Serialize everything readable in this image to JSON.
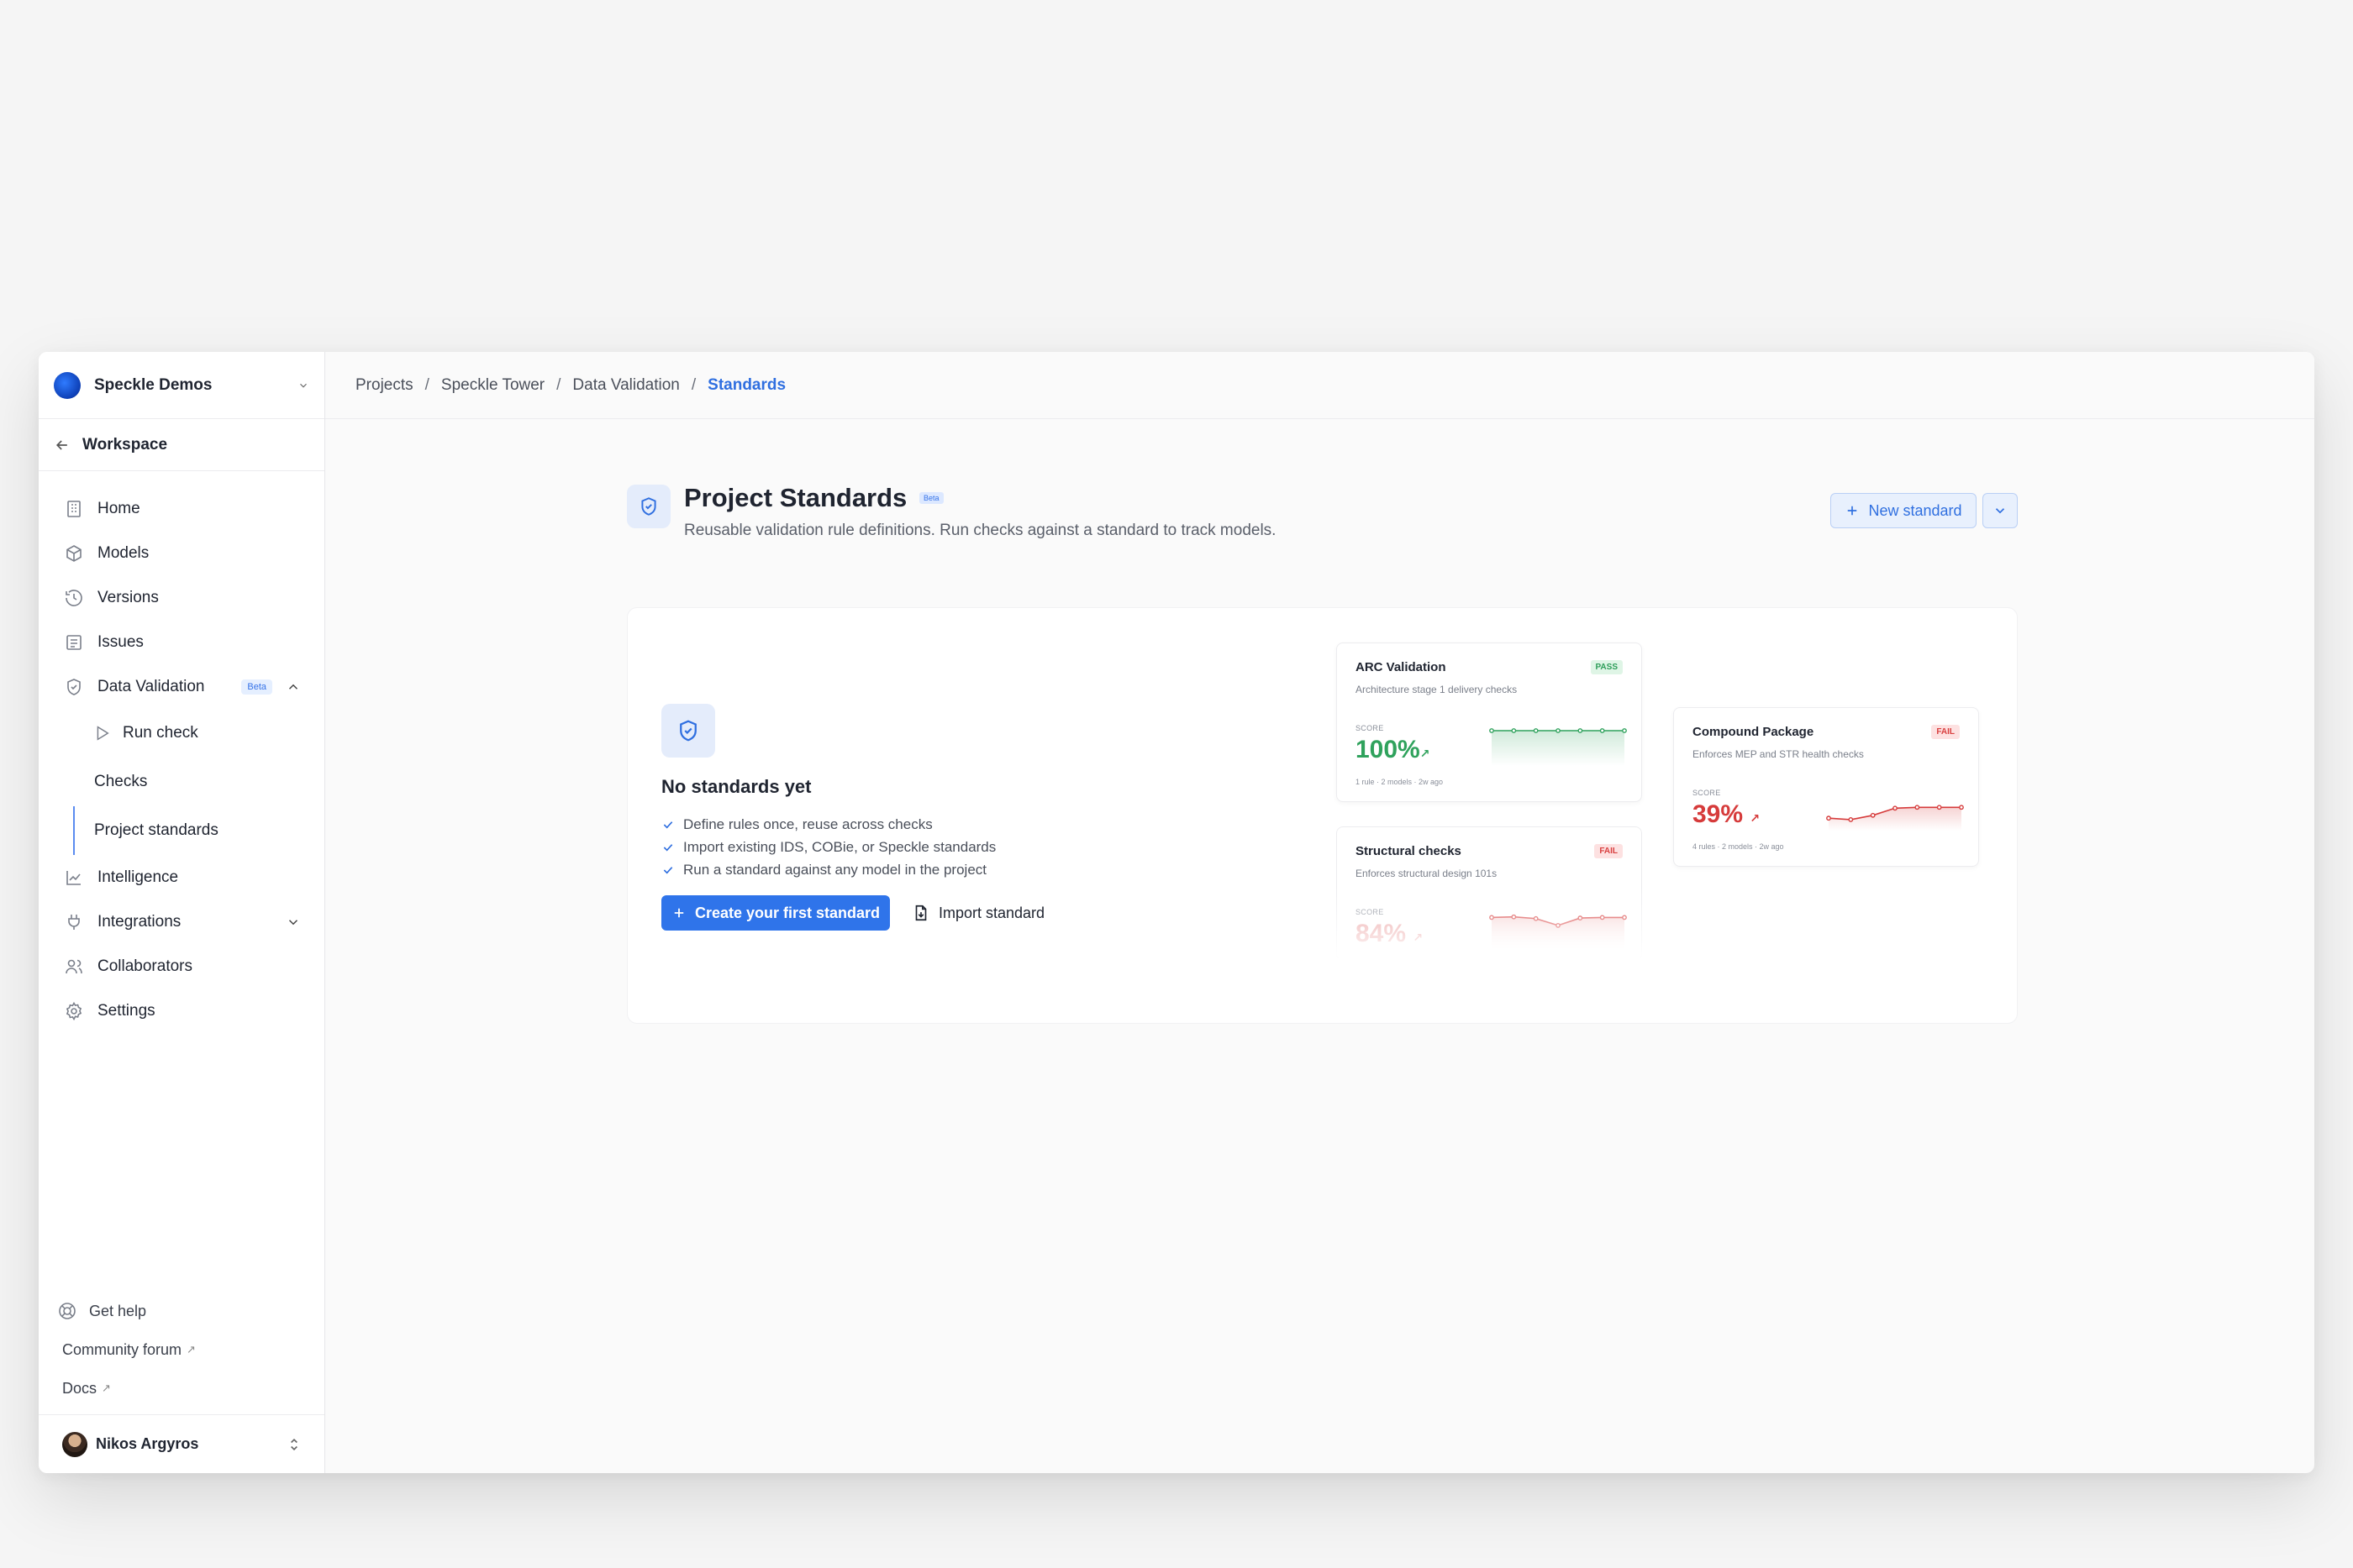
{
  "workspace": {
    "name": "Speckle Demos"
  },
  "back": {
    "label": "Workspace"
  },
  "nav": {
    "home": "Home",
    "models": "Models",
    "versions": "Versions",
    "issues": "Issues",
    "data_validation": "Data Validation",
    "data_validation_badge": "Beta",
    "run_check": "Run check",
    "checks": "Checks",
    "project_standards": "Project standards",
    "intelligence": "Intelligence",
    "integrations": "Integrations",
    "collaborators": "Collaborators",
    "settings": "Settings"
  },
  "help": {
    "get_help": "Get help",
    "community_forum": "Community forum",
    "docs": "Docs",
    "ext_glyph": "↗"
  },
  "user": {
    "name": "Nikos Argyros"
  },
  "breadcrumb": {
    "items": [
      "Projects",
      "Speckle Tower",
      "Data Validation",
      "Standards"
    ],
    "separator": "/"
  },
  "page": {
    "title": "Project Standards",
    "badge": "Beta",
    "subtitle": "Reusable validation rule definitions. Run checks against a standard to track models.",
    "new_button": "New standard"
  },
  "empty": {
    "title": "No standards yet",
    "bullets": [
      "Define rules once, reuse across checks",
      "Import existing IDS, COBie, or Speckle standards",
      "Run a standard against any model in the project"
    ],
    "create_button": "Create your first standard",
    "import_button": "Import standard"
  },
  "preview_cards": [
    {
      "title": "ARC Validation",
      "subtitle": "Architecture stage 1 delivery checks",
      "status": "PASS",
      "score_label": "SCORE",
      "score": "100%",
      "trend": "↗",
      "meta": "1 rule · 2 models · 2w ago",
      "color": "#2fa25c",
      "series": [
        100,
        100,
        100,
        100,
        100,
        100,
        100
      ]
    },
    {
      "title": "Compound Package",
      "subtitle": "Enforces MEP and STR health checks",
      "status": "FAIL",
      "score_label": "SCORE",
      "score": "39%",
      "trend": "↗",
      "meta": "4 rules · 2 models · 2w ago",
      "color": "#d63b3b",
      "series": [
        20,
        15,
        30,
        55,
        58,
        58,
        58
      ]
    },
    {
      "title": "Structural checks",
      "subtitle": "Enforces structural design 101s",
      "status": "FAIL",
      "score_label": "SCORE",
      "score": "84%",
      "trend": "↗",
      "meta": "",
      "color": "#d63b3b",
      "series": [
        90,
        92,
        86,
        62,
        88,
        90,
        90
      ]
    }
  ]
}
